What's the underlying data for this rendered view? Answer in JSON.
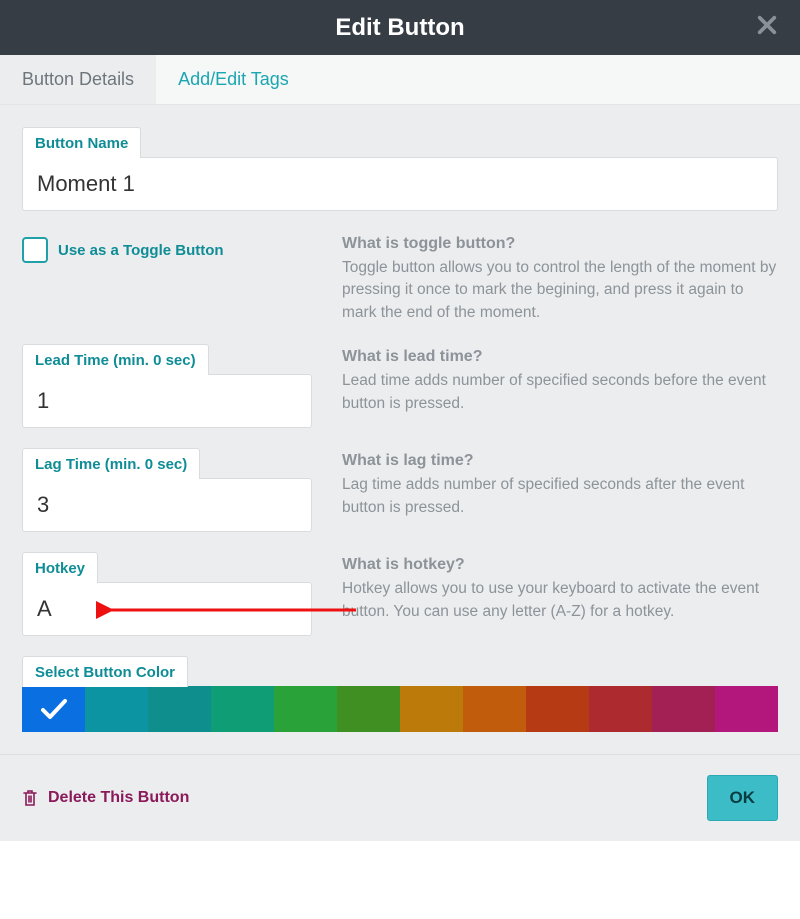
{
  "header": {
    "title": "Edit Button"
  },
  "tabs": {
    "details": "Button Details",
    "tags": "Add/Edit Tags"
  },
  "fields": {
    "name_label": "Button Name",
    "name_value": "Moment 1",
    "toggle_label": "Use as a Toggle Button",
    "lead_label": "Lead Time (min. 0 sec)",
    "lead_value": "1",
    "lag_label": "Lag Time (min. 0 sec)",
    "lag_value": "3",
    "hotkey_label": "Hotkey",
    "hotkey_value": "A",
    "select_color_label": "Select Button Color"
  },
  "help": {
    "toggle_title": "What is toggle button?",
    "toggle_text": "Toggle button allows you to control the length of the moment by pressing it once to mark the begining, and press it again to mark the end of the moment.",
    "lead_title": "What is lead time?",
    "lead_text": "Lead time adds number of specified seconds before the event button is pressed.",
    "lag_title": "What is lag time?",
    "lag_text": "Lag time adds number of specified seconds after the event button is pressed.",
    "hotkey_title": "What is hotkey?",
    "hotkey_text": "Hotkey allows you to use your keyboard to activate the event button. You can use any letter (A-Z) for a hotkey."
  },
  "colors": [
    "#0a6fe0",
    "#0d94a3",
    "#0e8f8d",
    "#0f9d76",
    "#29a23a",
    "#3f8f23",
    "#bb7a0a",
    "#c15c0c",
    "#b63a14",
    "#ad2a2f",
    "#a22054",
    "#b4177c"
  ],
  "selected_color_index": 0,
  "footer": {
    "delete_label": "Delete This Button",
    "ok_label": "OK"
  }
}
